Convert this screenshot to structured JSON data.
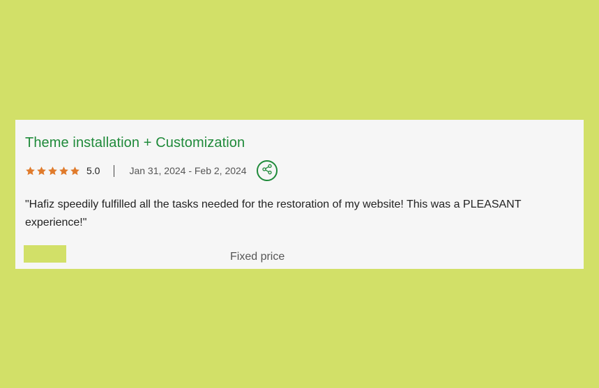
{
  "review": {
    "title": "Theme installation + Customization",
    "rating": "5.0",
    "stars_filled": 5,
    "stars_total": 5,
    "date_range": "Jan 31, 2024 - Feb 2, 2024",
    "share_icon": "share-icon",
    "quote": "\"Hafiz speedily fulfilled all the tasks needed for the restoration of my website! This was a PLEASANT experience!\"",
    "price_type": "Fixed price"
  },
  "colors": {
    "background": "#d2e068",
    "card": "#f6f6f6",
    "accent_green": "#1f8a3a",
    "star_orange": "#e07b2c",
    "text_dark": "#222222",
    "text_muted": "#555555"
  }
}
